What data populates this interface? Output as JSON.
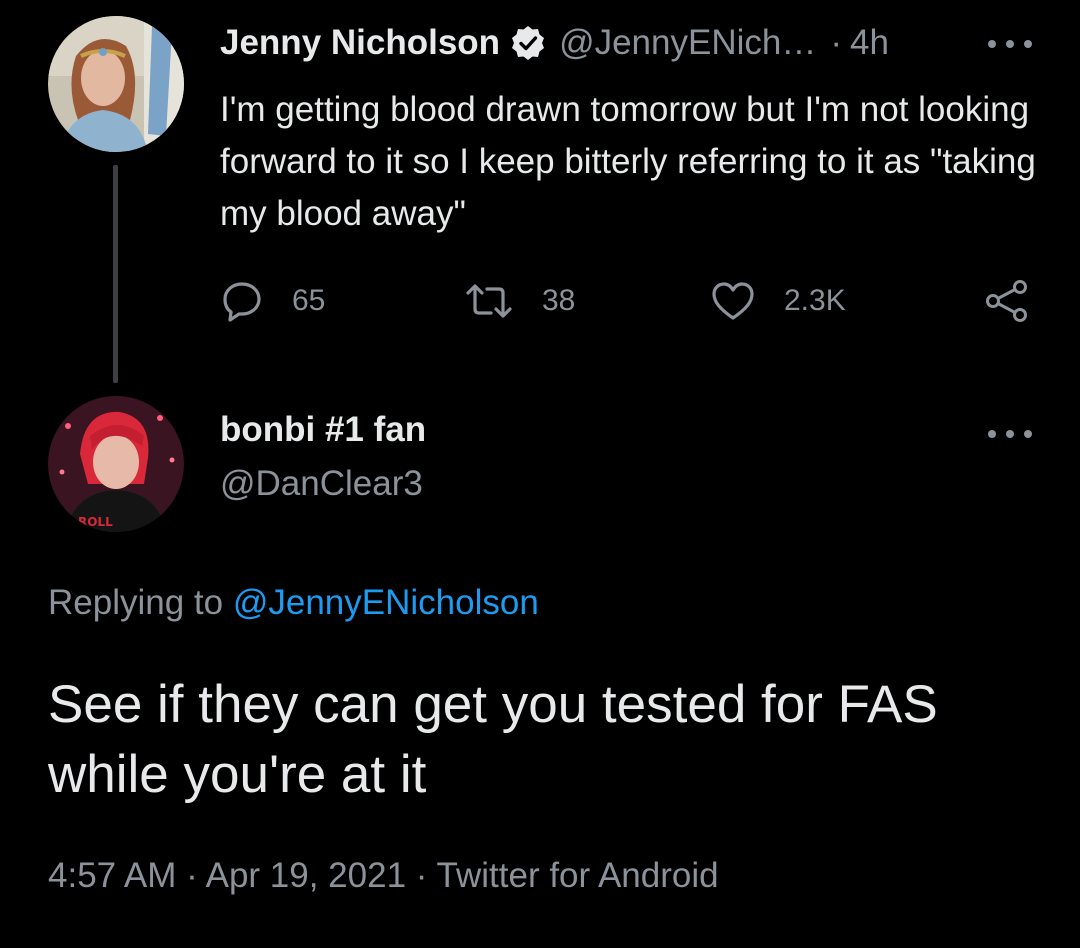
{
  "original_tweet": {
    "author_name": "Jenny Nicholson",
    "author_handle": "@JennyENich…",
    "separator": "·",
    "time_ago": "4h",
    "text": "I'm getting blood drawn tomorrow but I'm not looking forward to it so I keep bitterly referring to it as \"taking my blood away\"",
    "replies": "65",
    "retweets": "38",
    "likes": "2.3K",
    "verified_icon": "verified-badge-icon",
    "more_icon": "more-options-icon"
  },
  "reply_tweet": {
    "author_name": "bonbi #1 fan",
    "author_handle": "@DanClear3",
    "replying_prefix": "Replying to",
    "replying_to": "@JennyENicholson",
    "text": "See if they can get you tested for FAS while you're at it",
    "timestamp": "4:57 AM",
    "date": "Apr 19, 2021",
    "client": "Twitter for Android",
    "meta_separator": "·",
    "more_icon": "more-options-icon"
  },
  "icons": [
    "reply-icon",
    "retweet-icon",
    "like-icon",
    "share-icon"
  ],
  "colors": {
    "background": "#000000",
    "primary_text": "#e7e9ea",
    "secondary_text": "#8b9299",
    "link": "#1d9bf0",
    "thread_line": "#3d3f42"
  }
}
